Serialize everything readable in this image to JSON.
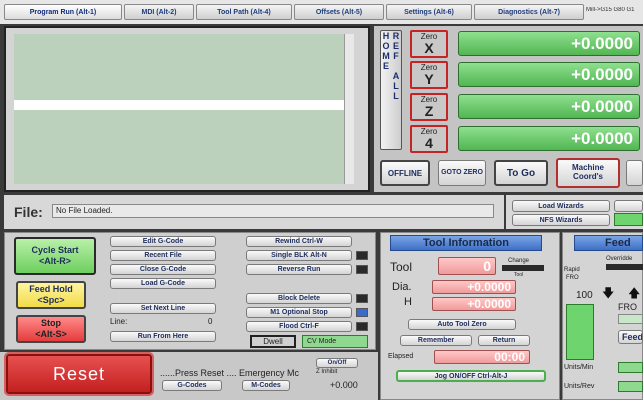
{
  "tabs": [
    {
      "label": "Program Run (Alt-1)",
      "active": true
    },
    {
      "label": "MDI (Alt-2)",
      "active": false
    },
    {
      "label": "Tool Path (Alt-4)",
      "active": false
    },
    {
      "label": "Offsets (Alt-5)",
      "active": false
    },
    {
      "label": "Settings (Alt-6)",
      "active": false
    },
    {
      "label": "Diagnostics (Alt-7)",
      "active": false
    }
  ],
  "status_right": "Mill->G15  G80 G1",
  "ref_all_home": "REF ALL HOME",
  "axes": [
    {
      "zero_top": "Zero",
      "zero_axis": "X",
      "value": "+0.0000"
    },
    {
      "zero_top": "Zero",
      "zero_axis": "Y",
      "value": "+0.0000"
    },
    {
      "zero_top": "Zero",
      "zero_axis": "Z",
      "value": "+0.0000"
    },
    {
      "zero_top": "Zero",
      "zero_axis": "4",
      "value": "+0.0000"
    }
  ],
  "dro_buttons": {
    "offline": "OFFLINE",
    "goto_zero": "GOTO ZERO",
    "to_go": "To Go",
    "machine_coords": "Machine Coord's"
  },
  "file": {
    "label": "File:",
    "value": "No File Loaded."
  },
  "wizards": {
    "load": "Load Wizards",
    "nfs": "NFS Wizards"
  },
  "cycle_start": {
    "line1": "Cycle Start",
    "line2": "<Alt-R>"
  },
  "feed_hold": {
    "line1": "Feed Hold",
    "line2": "<Spc>"
  },
  "stop": {
    "line1": "Stop",
    "line2": "<Alt-S>"
  },
  "gcode_buttons": {
    "edit": "Edit G-Code",
    "recent": "Recent File",
    "close": "Close G-Code",
    "load": "Load G-Code",
    "set_next": "Set Next Line",
    "run_from_here": "Run From Here"
  },
  "line": {
    "label": "Line:",
    "value": "0"
  },
  "run_buttons": {
    "rewind": "Rewind Ctrl-W",
    "single_blk": "Single BLK Alt-N",
    "reverse": "Reverse Run",
    "block_delete": "Block Delete",
    "m1_optional": "M1 Optional Stop",
    "flood": "Flood Ctrl-F"
  },
  "dwell": "Dwell",
  "cv_mode": "CV Mode",
  "reset": "Reset",
  "marquee": "......Press Reset .... Emergency Mc",
  "onoff": "On/Off",
  "z_inhibit": "Z Inhibit",
  "z_inhibit_value": "+0.000",
  "gcodes_btn": "G-Codes",
  "mcodes_btn": "M-Codes",
  "tool_info": {
    "title": "Tool Information",
    "tool_label": "Tool",
    "tool_value": "0",
    "change": "Change",
    "tool_sub": "Tool",
    "dia_label": "Dia.",
    "dia_value": "+0.0000",
    "h_label": "H",
    "h_value": "+0.0000",
    "auto_zero": "Auto Tool Zero",
    "remember": "Remember",
    "return": "Return",
    "elapsed_label": "Elapsed",
    "elapsed_value": "00:00",
    "jog": "Jog ON/OFF Ctrl-Alt-J"
  },
  "feed": {
    "title": "Feed",
    "overridden": "Overridde",
    "rapid": "Rapid",
    "fro_small": "FRO",
    "fro_value": "100",
    "fro_big": "FRO",
    "feed_word": "Feed",
    "units_min": "Units/Min",
    "units_rev": "Units/Rev"
  }
}
